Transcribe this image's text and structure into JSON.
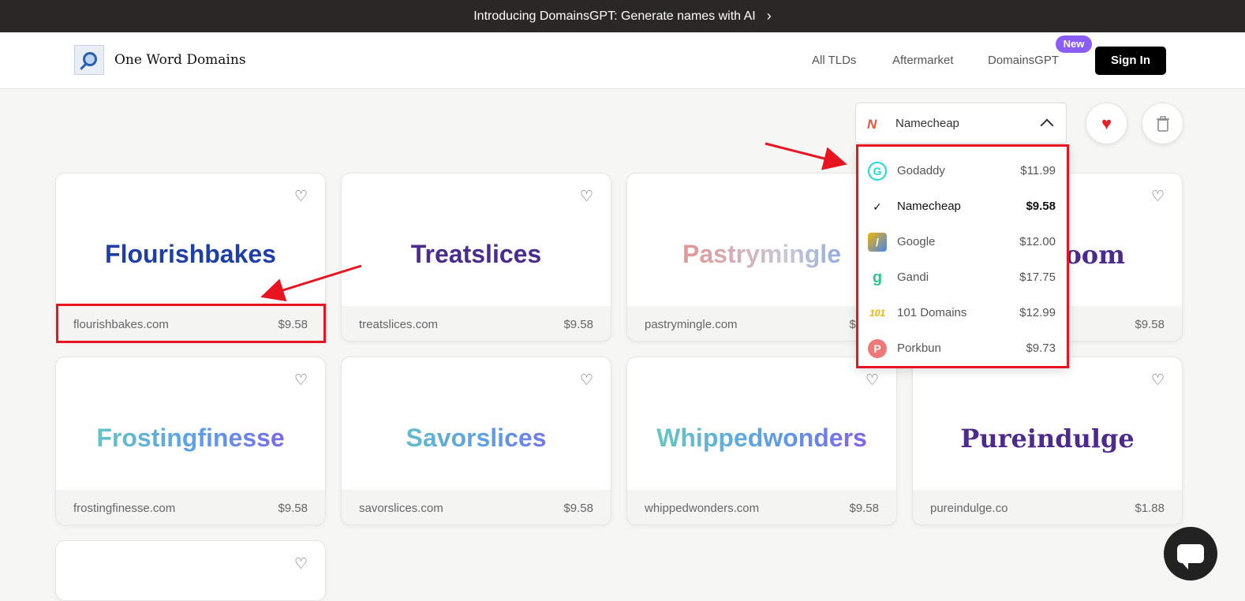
{
  "announcement": {
    "text": "Introducing DomainsGPT: Generate names with AI",
    "chevron": "›"
  },
  "header": {
    "brand": "One Word Domains",
    "nav": [
      {
        "label": "All TLDs"
      },
      {
        "label": "Aftermarket"
      },
      {
        "label": "DomainsGPT"
      }
    ],
    "new_badge": "New",
    "sign_in": "Sign In"
  },
  "registrar_select": {
    "selected": "Namecheap",
    "logo_glyph": "N"
  },
  "dropdown": {
    "items": [
      {
        "name": "Godaddy",
        "price": "$11.99",
        "icon": "godaddy-icon",
        "glyph": "G",
        "color": "#1bdbdb",
        "selected": false
      },
      {
        "name": "Namecheap",
        "price": "$9.58",
        "icon": "check-icon",
        "glyph": "✓",
        "color": "#111111",
        "selected": true
      },
      {
        "name": "Google",
        "price": "$12.00",
        "icon": "google-domains-icon",
        "glyph": "/",
        "color": "#4285f4",
        "selected": false
      },
      {
        "name": "Gandi",
        "price": "$17.75",
        "icon": "gandi-icon",
        "glyph": "g",
        "color": "#29c98f",
        "selected": false
      },
      {
        "name": "101 Domains",
        "price": "$12.99",
        "icon": "101domains-icon",
        "glyph": "101",
        "color": "#f0b400",
        "selected": false
      },
      {
        "name": "Porkbun",
        "price": "$9.73",
        "icon": "porkbun-icon",
        "glyph": "P",
        "color": "#ef7878",
        "selected": false
      }
    ]
  },
  "cards": [
    {
      "name": "Flourishbakes",
      "domain": "flourishbakes.com",
      "price": "$9.58",
      "color": "#1f3fa8"
    },
    {
      "name": "Treatslices",
      "domain": "treatslices.com",
      "price": "$9.58",
      "color": "#4b2b8e"
    },
    {
      "name": "Pastrymingle",
      "domain": "pastrymingle.com",
      "price": "$9.58",
      "color": "#f07b74"
    },
    {
      "name": "loom",
      "domain": "",
      "price": "$9.58",
      "color": "#4b2b8e"
    },
    {
      "name": "Frostingfinesse",
      "domain": "frostingfinesse.com",
      "price": "$9.58",
      "color": "#69d1b8"
    },
    {
      "name": "Savorslices",
      "domain": "savorslices.com",
      "price": "$9.58",
      "color": "#69d1b8"
    },
    {
      "name": "Whippedwonders",
      "domain": "whippedwonders.com",
      "price": "$9.58",
      "color": "#69d1b8"
    },
    {
      "name": "Pureindulge",
      "domain": "pureindulge.co",
      "price": "$1.88",
      "color": "#4e2a8f"
    }
  ],
  "accent": {
    "highlight": "#e8141f",
    "favorite": "#e8202a"
  }
}
